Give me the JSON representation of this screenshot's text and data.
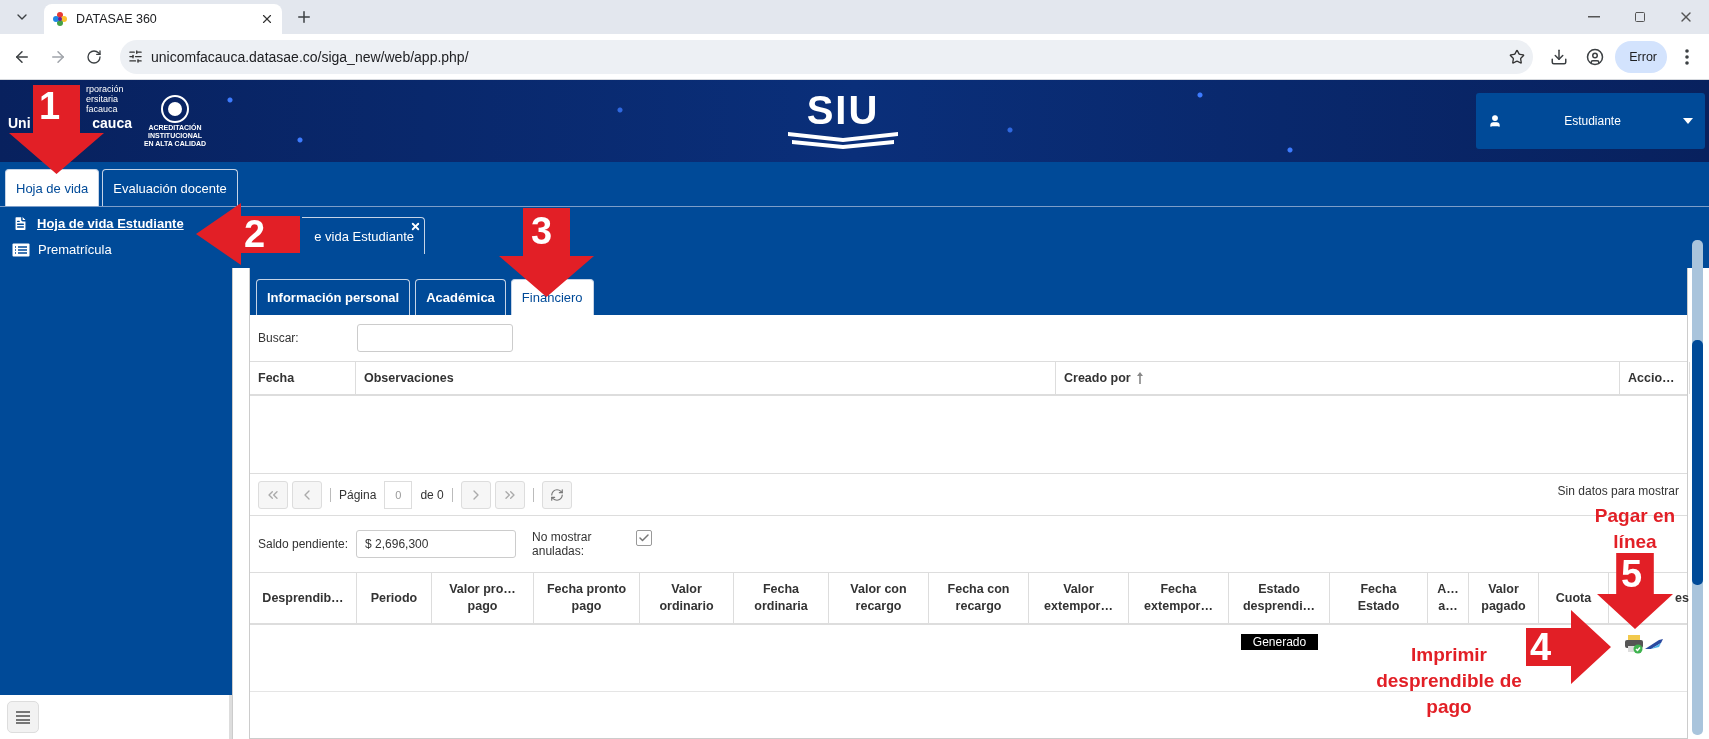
{
  "browser": {
    "tab_title": "DATASAE 360",
    "url": "unicomfacauca.datasae.co/siga_new/web/app.php/",
    "profile_label": "Error"
  },
  "header": {
    "logo_lines": [
      "rporación",
      "ersitaria",
      "facauca"
    ],
    "logo_brand": [
      "Uni",
      "cauca"
    ],
    "accreditation_lines": [
      "ACREDITACIÓN",
      "INSTITUCIONAL",
      "EN ALTA CALIDAD"
    ],
    "app_logo": "SIU",
    "user_role": "Estudiante"
  },
  "top_tabs": [
    {
      "label": "Hoja de vida",
      "selected": true
    },
    {
      "label": "Evaluación docente",
      "selected": false
    }
  ],
  "sidebar": {
    "items": [
      {
        "label": "Hoja de vida Estudiante",
        "selected": true,
        "kind": "document"
      },
      {
        "label": "Prematrícula",
        "selected": false,
        "kind": "list"
      }
    ]
  },
  "document_tab": {
    "label": "e vida Estudiante"
  },
  "section_tabs": [
    {
      "label": "Información personal",
      "selected": false
    },
    {
      "label": "Académica",
      "selected": false
    },
    {
      "label": "Financiero",
      "selected": true
    }
  ],
  "search": {
    "label": "Buscar:"
  },
  "notes_table": {
    "columns": [
      {
        "label": "Fecha"
      },
      {
        "label": "Observaciones"
      },
      {
        "label": "Creado por",
        "sorted": true
      },
      {
        "label": "Accio…"
      }
    ]
  },
  "pager": {
    "page_label": "Página",
    "page_value": "0",
    "page_total": "de 0",
    "status": "Sin datos para mostrar"
  },
  "balance": {
    "label": "Saldo pendiente:",
    "value": "$ 2,696,300",
    "hide_voided_label": "No mostrar\nanuladas:",
    "hide_voided": true
  },
  "payments_table": {
    "columns": [
      "Desprendib…",
      "Periodo",
      "Valor pro…\npago",
      "Fecha pronto\npago",
      "Valor\nordinario",
      "Fecha\nordinaria",
      "Valor con\nrecargo",
      "Fecha con\nrecargo",
      "Valor\nextempor…",
      "Fecha\nextempor…",
      "Estado\ndesprendi…",
      "Fecha\nEstado",
      "A…\na…",
      "Valor\npagado",
      "Cuota",
      "es"
    ],
    "rows": [
      {
        "status": "Generado"
      }
    ]
  },
  "annotations": [
    {
      "number": "1",
      "kind": "down"
    },
    {
      "number": "2",
      "kind": "left"
    },
    {
      "number": "3",
      "kind": "down"
    },
    {
      "number": "4",
      "kind": "right",
      "caption": "Imprimir desprendible de pago"
    },
    {
      "number": "5",
      "kind": "down",
      "caption": "Pagar en línea"
    }
  ]
}
